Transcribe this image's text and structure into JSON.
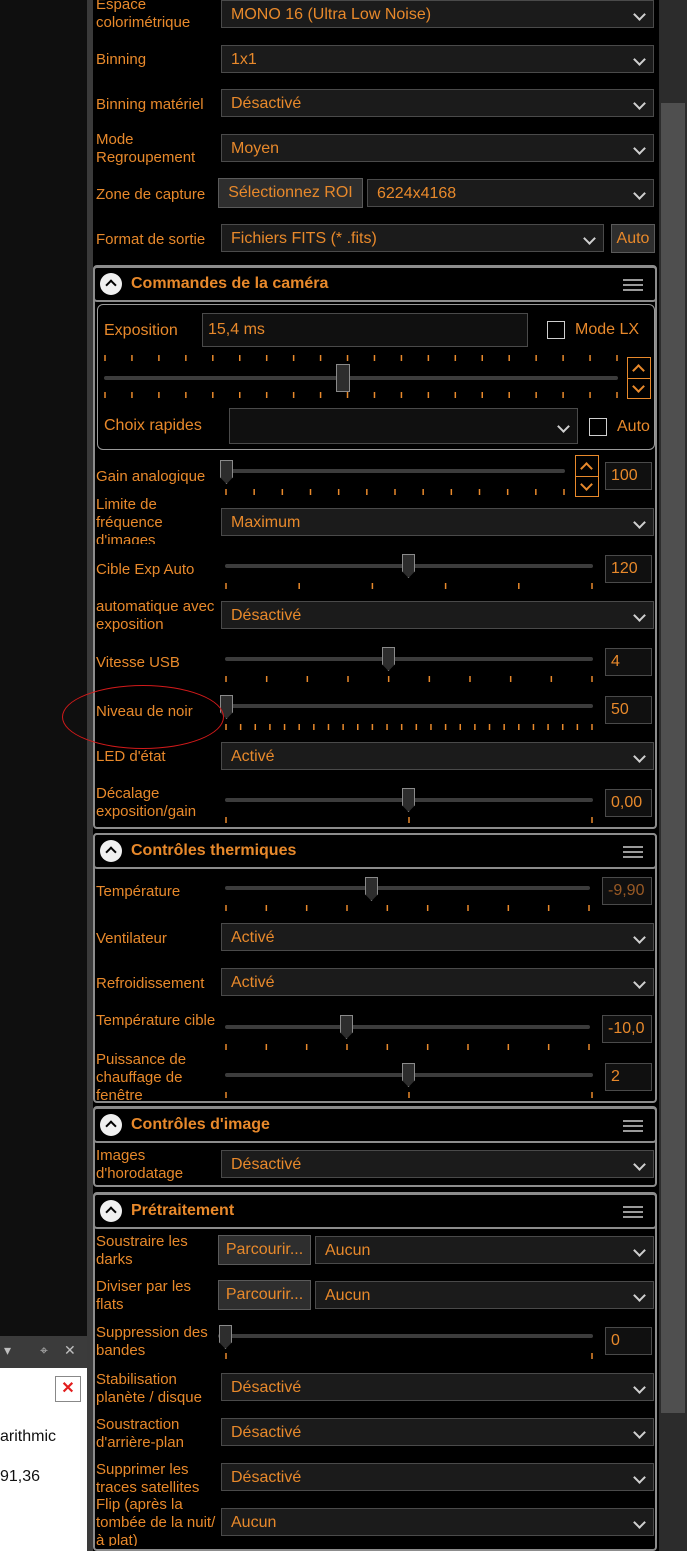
{
  "float_panel": {
    "header_controls": [
      "▾",
      "⌖",
      "✕"
    ],
    "text_line1": "arithmic",
    "text_line2": "91,36"
  },
  "rows": {
    "color_space": {
      "label": "Espace colorimétrique",
      "value": "MONO 16 (Ultra Low Noise)"
    },
    "binning": {
      "label": "Binning",
      "value": "1x1"
    },
    "hw_binning": {
      "label": "Binning matériel",
      "value": "Désactivé"
    },
    "group_mode": {
      "label": "Mode Regroupement",
      "value": "Moyen"
    },
    "capture_zone": {
      "label": "Zone de capture",
      "button": "Sélectionnez ROI",
      "value": "6224x4168"
    },
    "output_format": {
      "label": "Format de sortie",
      "value": "Fichiers FITS (* .fits)",
      "auto_button": "Auto"
    }
  },
  "camera_commands": {
    "title": "Commandes de la caméra",
    "exposure": {
      "label": "Exposition",
      "value": "15,4 ms",
      "checkbox_label": "Mode LX",
      "slider": 0.46
    },
    "quick_choices": {
      "label": "Choix rapides",
      "value": "",
      "checkbox_label": "Auto"
    },
    "analog_gain": {
      "label": "Gain analogique",
      "value": "100",
      "slider": 0.0
    },
    "fps_limit": {
      "label": "Limite de fréquence d'images",
      "value": "Maximum"
    },
    "auto_exp_target": {
      "label": "Cible Exp Auto",
      "value": "120",
      "slider": 0.5
    },
    "auto_with_exposure": {
      "label": "automatique avec exposition",
      "value": "Désactivé"
    },
    "usb_speed": {
      "label": "Vitesse USB",
      "value": "4",
      "slider": 0.44
    },
    "black_level": {
      "label": "Niveau de noir",
      "value": "50",
      "slider": 0.0
    },
    "status_led": {
      "label": "LED d'état",
      "value": "Activé"
    },
    "exposure_gain_offset": {
      "label": "Décalage exposition/gain",
      "value": "0,00",
      "slider": 0.5
    }
  },
  "thermal": {
    "title": "Contrôles thermiques",
    "temperature": {
      "label": "Température",
      "value": "-9,90",
      "slider": 0.4
    },
    "fan": {
      "label": "Ventilateur",
      "value": "Activé"
    },
    "cooling": {
      "label": "Refroidissement",
      "value": "Activé"
    },
    "target_temp": {
      "label": "Température cible",
      "value": "-10,0",
      "slider": 0.33
    },
    "window_heater": {
      "label": "Puissance de chauffage de fenêtre",
      "value": "2",
      "slider": 0.5
    }
  },
  "image_controls": {
    "title": "Contrôles d'image",
    "timestamp": {
      "label": "Images d'horodatage",
      "value": "Désactivé"
    }
  },
  "preprocessing": {
    "title": "Prétraitement",
    "darks": {
      "label": "Soustraire les darks",
      "button": "Parcourir...",
      "value": "Aucun"
    },
    "flats": {
      "label": "Diviser par les flats",
      "button": "Parcourir...",
      "value": "Aucun"
    },
    "banding": {
      "label": "Suppression des bandes",
      "value": "0",
      "slider": 0.0
    },
    "stabilization": {
      "label": "Stabilisation planète / disque",
      "value": "Désactivé"
    },
    "bg_subtraction": {
      "label": "Soustraction d'arrière-plan",
      "value": "Désactivé"
    },
    "satellite": {
      "label": "Supprimer les traces satellites",
      "value": "Désactivé"
    },
    "flip": {
      "label": "Flip (après la tombée de la nuit/à plat)",
      "value": "Aucun"
    }
  },
  "colors": {
    "accent": "#e8892b",
    "background": "#000000",
    "annotation": "#d11a1a"
  }
}
